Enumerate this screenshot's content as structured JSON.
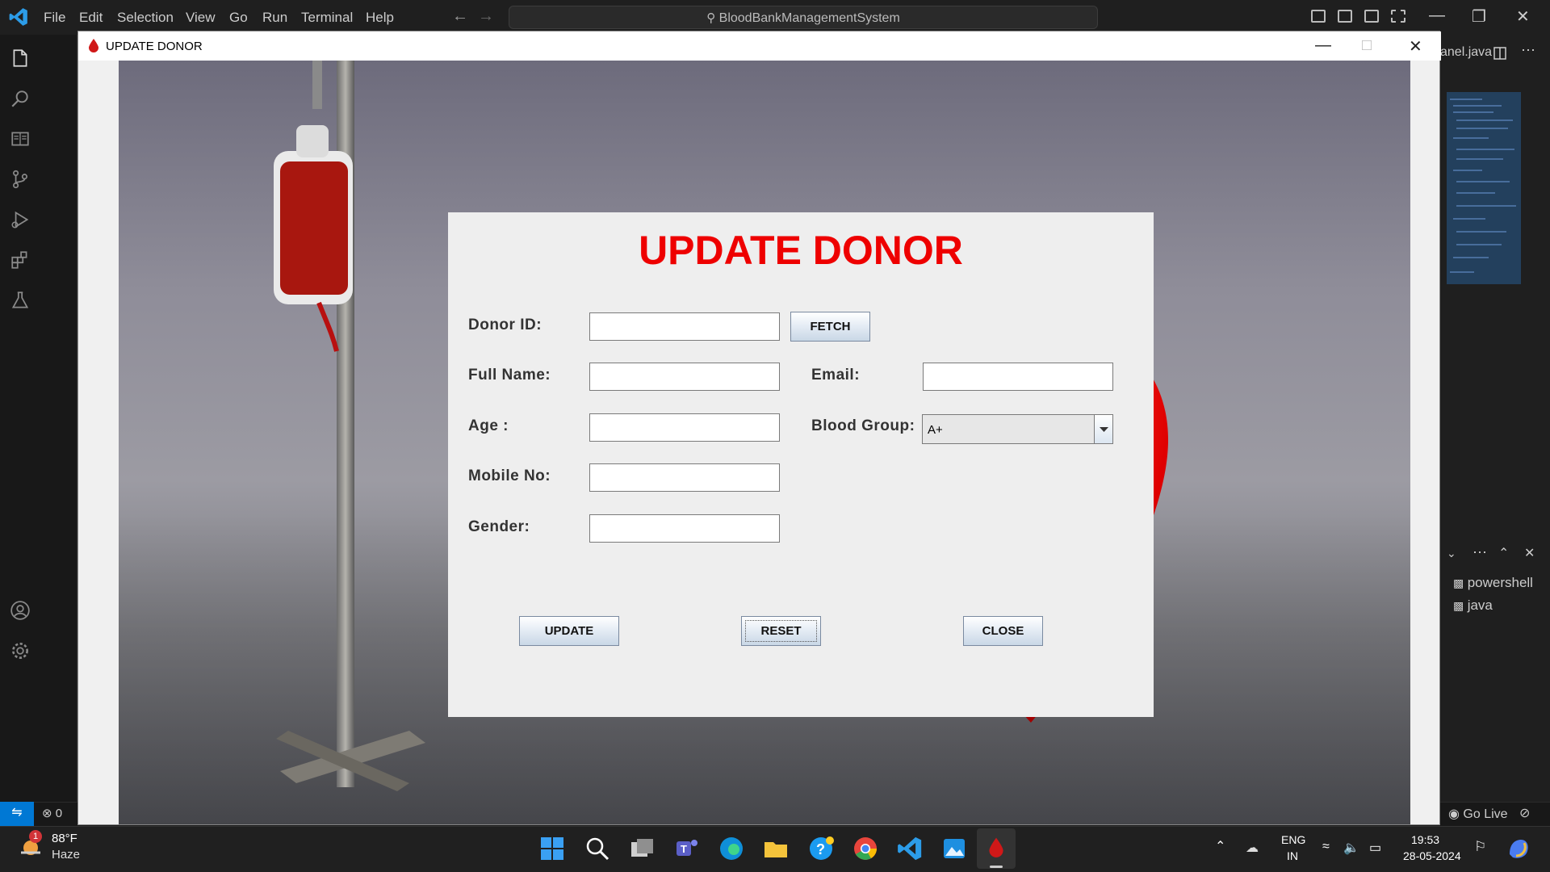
{
  "vscode": {
    "menu": [
      "File",
      "Edit",
      "Selection",
      "View",
      "Go",
      "Run",
      "Terminal",
      "Help"
    ],
    "search_text": "BloodBankManagementSystem",
    "tab_label": "anel.java",
    "terminals": [
      "powershell",
      "java"
    ],
    "status_errors": "0",
    "go_live": "Go Live"
  },
  "java_window": {
    "title": "UPDATE DONOR"
  },
  "dialog": {
    "heading": "UPDATE DONOR",
    "labels": {
      "donor_id": "Donor ID:",
      "full_name": "Full Name:",
      "age": "Age :",
      "mobile": "Mobile No:",
      "gender": "Gender:",
      "email": "Email:",
      "blood_group": "Blood Group:"
    },
    "values": {
      "donor_id": "",
      "full_name": "",
      "age": "",
      "mobile": "",
      "gender": "",
      "email": ""
    },
    "blood_group_selected": "A+",
    "buttons": {
      "fetch": "FETCH",
      "update": "UPDATE",
      "reset": "RESET",
      "close": "CLOSE"
    }
  },
  "taskbar": {
    "weather_temp": "88°F",
    "weather_desc": "Haze",
    "weather_badge": "1",
    "lang_line1": "ENG",
    "lang_line2": "IN",
    "time": "19:53",
    "date": "28-05-2024"
  },
  "colors": {
    "heading": "#ee0000",
    "vscode_accent": "#0078d4"
  }
}
